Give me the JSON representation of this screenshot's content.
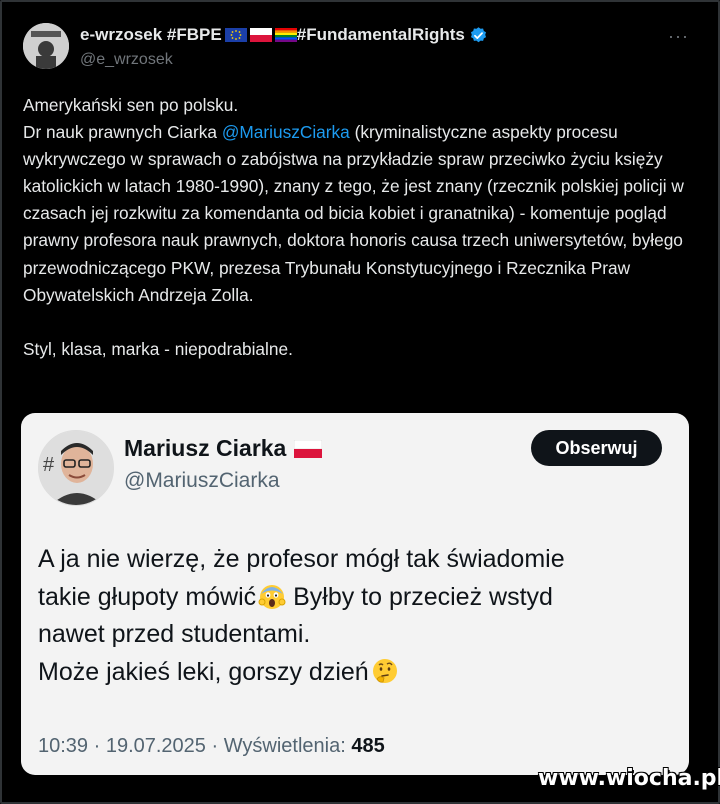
{
  "tweet": {
    "author": {
      "name": "e-wrzosek #FBPE",
      "name_suffix": "#FundamentalRights",
      "handle": "@e_wrzosek",
      "flags": [
        "eu-flag-icon",
        "poland-flag-icon",
        "rainbow-flag-icon"
      ],
      "verified_icon": "verified-badge-icon"
    },
    "more_label": "···",
    "lines": [
      "Amerykański sen po polsku.",
      "Dr nauk prawnych Ciarka ",
      " (kryminalistyczne aspekty procesu wykrywczego w sprawach o zabójstwa na przykładzie spraw przeciwko życiu księży katolickich w latach 1980-1990), znany z tego, że jest znany (rzecznik polskiej policji w czasach jej rozkwitu za komendanta od bicia kobiet i granatnika) - komentuje pogląd prawny profesora nauk prawnych, doktora honoris causa trzech uniwersytetów, byłego  przewodniczącego PKW, prezesa Trybunału Konstytucyjnego i Rzecznika Praw Obywatelskich Andrzeja Zolla.",
      "Styl, klasa, marka - niepodrabialne."
    ],
    "mention": "@MariuszCiarka"
  },
  "quote": {
    "name": "Mariusz Ciarka",
    "handle": "@MariuszCiarka",
    "follow_label": "Obserwuj",
    "text_lines": [
      "A ja nie wierzę, że profesor mógł tak świadomie",
      "takie głupoty mówić",
      " Byłby to przecież wstyd",
      "nawet przed studentami.",
      "Może jakieś leki, gorszy dzień"
    ],
    "emojis": [
      "screaming-face-icon",
      "thinking-face-icon"
    ],
    "time": "10:39 · 19.07.2025 · Wyświetlenia: ",
    "views": "485"
  },
  "watermark": "www.wiocha.pl",
  "colors": {
    "background": "#000000",
    "text": "#e7e9ea",
    "muted": "#71767b",
    "link": "#1d9bf0",
    "card": "#f3f3f3",
    "button": "#0f1419"
  }
}
